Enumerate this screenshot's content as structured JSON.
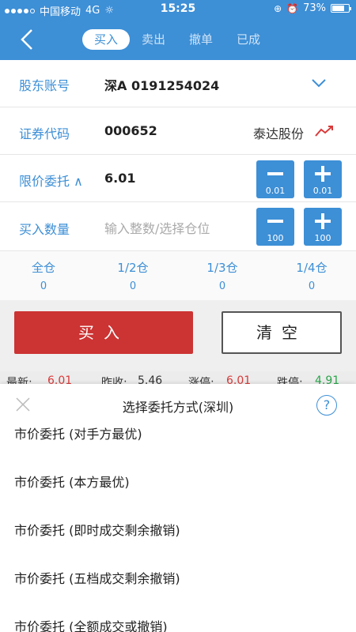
{
  "status": {
    "carrier": "中国移动",
    "network": "4G",
    "time": "15:25",
    "battery_text": "73%",
    "battery_level": 0.73
  },
  "nav": {
    "tabs": [
      {
        "label": "买入",
        "active": true
      },
      {
        "label": "卖出",
        "active": false
      },
      {
        "label": "撤单",
        "active": false
      },
      {
        "label": "已成",
        "active": false
      }
    ]
  },
  "form": {
    "account_label": "股东账号",
    "account_value": "深A 0191254024",
    "code_label": "证券代码",
    "code_value": "000652",
    "stock_name": "泰达股份",
    "price_label": "限价委托 ∧",
    "price_value": "6.01",
    "price_dec": "0.01",
    "price_inc": "0.01",
    "qty_label": "买入数量",
    "qty_placeholder": "输入整数/选择仓位",
    "qty_dec": "100",
    "qty_inc": "100"
  },
  "positions": [
    {
      "label": "全仓",
      "count": "0"
    },
    {
      "label": "1/2仓",
      "count": "0"
    },
    {
      "label": "1/3仓",
      "count": "0"
    },
    {
      "label": "1/4仓",
      "count": "0"
    }
  ],
  "actions": {
    "buy": "买入",
    "clear": "清空"
  },
  "quote": {
    "latest_label": "最新:",
    "latest_value": "6.01",
    "prev_close_label": "昨收:",
    "prev_close_value": "5.46",
    "limit_up_label": "涨停:",
    "limit_up_value": "6.01",
    "limit_down_label": "跌停:",
    "limit_down_value": "4.91"
  },
  "sheet": {
    "title": "选择委托方式(深圳)",
    "help": "?",
    "options": [
      "市价委托 (对手方最优)",
      "市价委托 (本方最优)",
      "市价委托 (即时成交剩余撤销)",
      "市价委托 (五档成交剩余撤销)",
      "市价委托 (全额成交或撤销)"
    ]
  },
  "colors": {
    "primary": "#3d8fd6",
    "buy_red": "#cc3333",
    "up_red": "#d93a3a",
    "down_green": "#2aa54a"
  }
}
